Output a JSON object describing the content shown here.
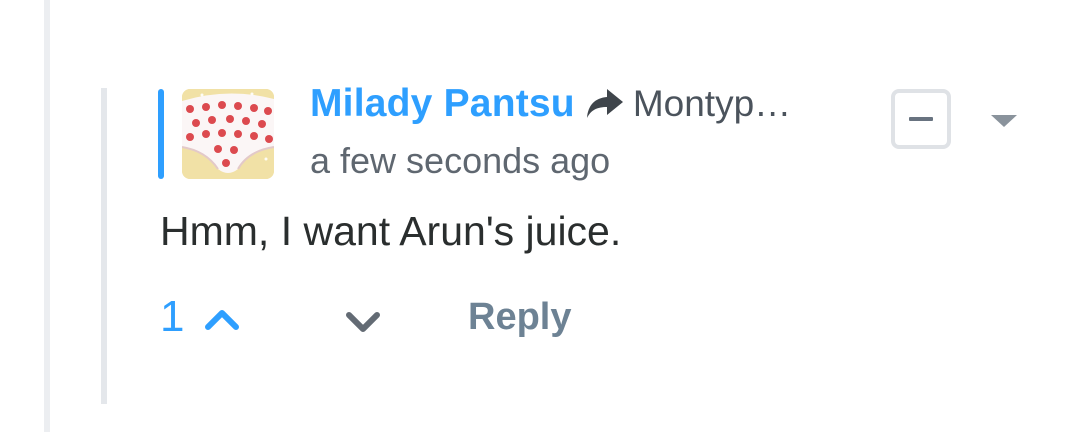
{
  "comment": {
    "author": "Milady Pantsu",
    "in_reply_to": "Montyp…",
    "timestamp": "a few seconds ago",
    "body": "Hmm, I want Arun's juice.",
    "vote_count": "1",
    "reply_label": "Reply"
  },
  "icons": {
    "reply_to": "share-arrow-icon",
    "collapse": "minus-icon",
    "menu": "caret-down-icon",
    "upvote": "chevron-up-icon",
    "downvote": "chevron-down-icon"
  },
  "colors": {
    "accent": "#2e9fff",
    "author": "#2e9fff",
    "reply_link": "#6d8294",
    "body_text": "#2a2e2e"
  }
}
